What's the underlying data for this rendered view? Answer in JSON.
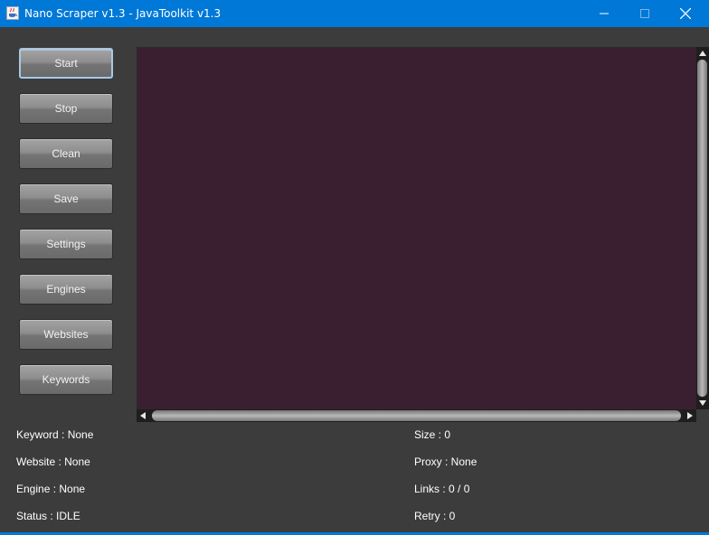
{
  "window": {
    "title": "Nano Scraper v1.3 - JavaToolkit v1.3",
    "icons": {
      "app": "java-app-icon",
      "minimize": "minimize-icon",
      "maximize": "maximize-icon",
      "close": "close-icon"
    },
    "colors": {
      "titlebar": "#0078d7",
      "background": "#3c3c3c",
      "output": "#3a1f31"
    }
  },
  "sidebar": {
    "buttons": [
      "Start",
      "Stop",
      "Clean",
      "Save",
      "Settings",
      "Engines",
      "Websites",
      "Keywords"
    ],
    "focused": "Start"
  },
  "output": {
    "text": ""
  },
  "status": {
    "left": [
      "Keyword : None",
      "Website : None",
      "Engine : None",
      "Status : IDLE"
    ],
    "right": [
      "Size : 0",
      "Proxy : None",
      "Links : 0 / 0",
      "Retry : 0"
    ]
  }
}
